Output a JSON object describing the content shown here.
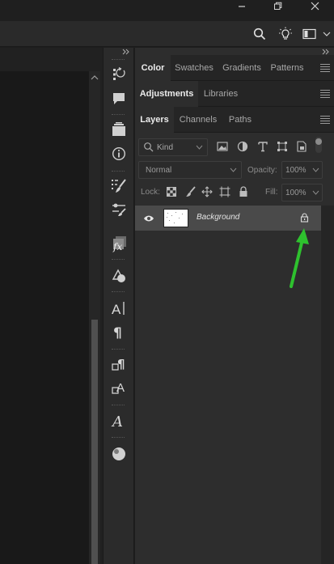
{
  "window": {
    "minimize_icon": "minimize-icon",
    "restore_icon": "restore-icon",
    "close_icon": "close-icon"
  },
  "options_bar": {
    "icons": [
      "search-icon",
      "lightbulb-icon",
      "workspace-icon",
      "chevron-down-icon"
    ]
  },
  "panel_groups": {
    "group1": {
      "tabs": [
        "Color",
        "Swatches",
        "Gradients",
        "Patterns"
      ],
      "active": "Color"
    },
    "group2": {
      "tabs": [
        "Adjustments",
        "Libraries"
      ],
      "active": "Adjustments"
    },
    "group3": {
      "tabs": [
        "Layers",
        "Channels",
        "Paths"
      ],
      "active": "Layers"
    }
  },
  "layers": {
    "filter_kind": "Kind",
    "blend_mode": "Normal",
    "opacity_label": "Opacity:",
    "opacity_value": "100%",
    "lock_label": "Lock:",
    "fill_label": "Fill:",
    "fill_value": "100%",
    "items": [
      {
        "name": "Background",
        "visible": true,
        "locked": true
      }
    ]
  },
  "annotation": {
    "arrow_color": "#2ec12e"
  },
  "colors": {
    "accent_arrow": "#2ec12e",
    "selected_row": "#4a4a4a"
  }
}
